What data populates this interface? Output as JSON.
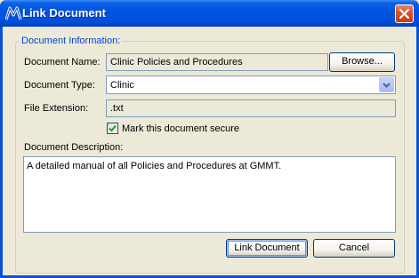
{
  "window": {
    "title": "Link Document",
    "icon": "mediware-m-icon"
  },
  "group": {
    "legend": "Document Information:"
  },
  "form": {
    "document_name_label": "Document Name:",
    "document_name_value": "Clinic Policies and Procedures",
    "browse_label": "Browse...",
    "document_type_label": "Document Type:",
    "document_type_value": "Clinic",
    "file_extension_label": "File Extension:",
    "file_extension_value": ".txt",
    "secure_checkbox_label": "Mark this document secure",
    "secure_checked": true,
    "description_label": "Document Description:",
    "description_value": "A detailed manual of all Policies and Procedures at GMMT."
  },
  "buttons": {
    "link_document": "Link Document",
    "cancel": "Cancel"
  },
  "colors": {
    "titlebar": "#0054e3",
    "dialog_bg": "#ece9d8",
    "legend_text": "#0046d5",
    "field_border": "#7f9db9"
  }
}
